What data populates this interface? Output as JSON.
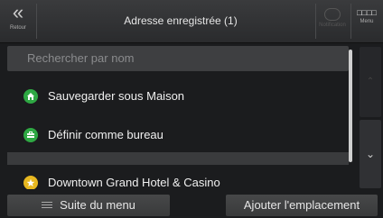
{
  "topbar": {
    "back_glyph": "«",
    "back_label": "Retour",
    "title": "Adresse enregistrée (1)",
    "notifications_label": "Notification",
    "menu_label": "Menu",
    "menu_glyph": "□□□□"
  },
  "search": {
    "placeholder": "Rechercher par nom"
  },
  "list": {
    "items": [
      {
        "label": "Sauvegarder sous Maison",
        "icon": "home-icon",
        "icon_color": "#2ea843"
      },
      {
        "label": "Définir comme bureau",
        "icon": "briefcase-icon",
        "icon_color": "#2ea843"
      },
      {
        "label": "Downtown Grand Hotel & Casino",
        "icon": "star-icon",
        "icon_color": "#e8b820"
      }
    ]
  },
  "scroll": {
    "up_glyph": "⌃",
    "down_glyph": "⌄"
  },
  "bottom": {
    "more_label": "Suite du menu",
    "add_label": "Ajouter l'emplacement"
  }
}
